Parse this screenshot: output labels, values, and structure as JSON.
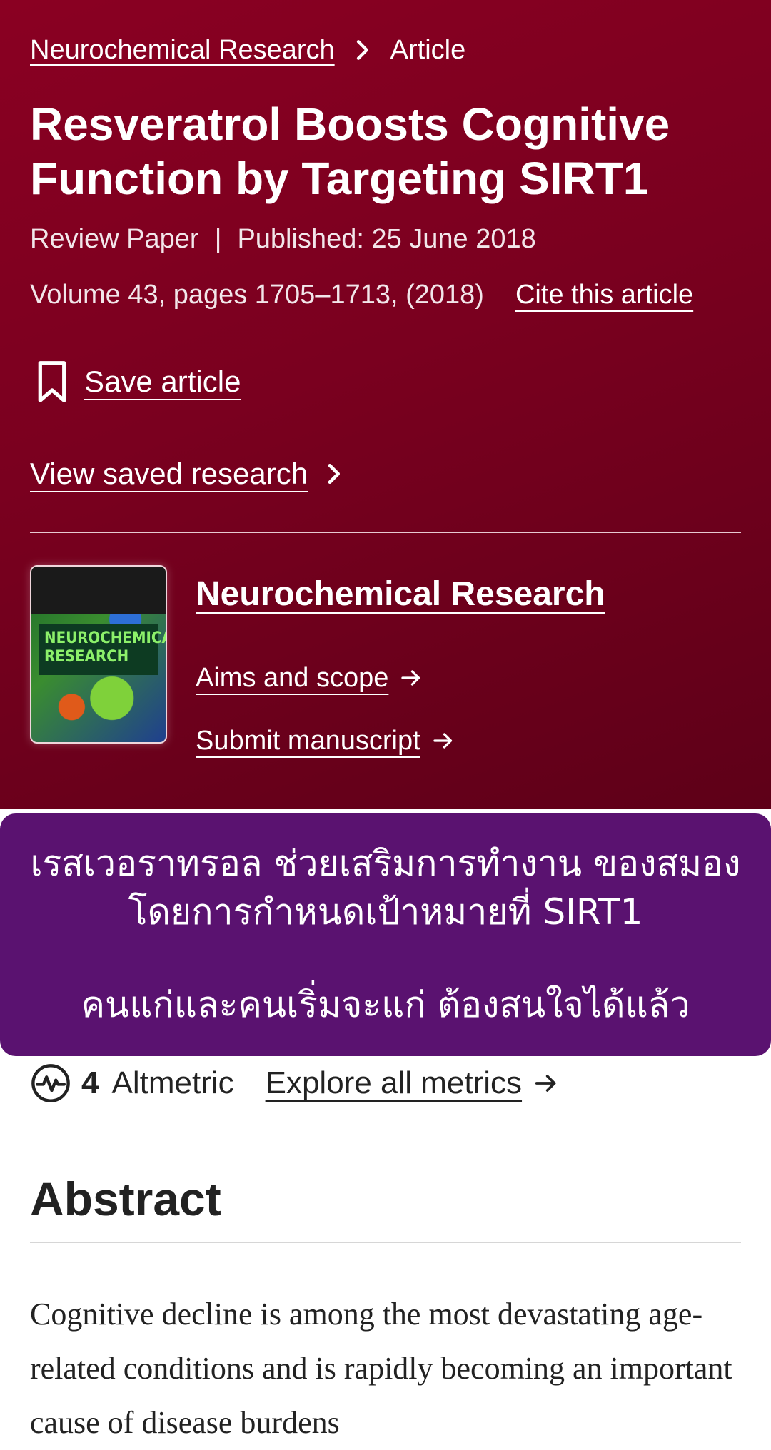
{
  "breadcrumb": {
    "journal_link": "Neurochemical Research",
    "current": "Article"
  },
  "article": {
    "title": "Resveratrol Boosts Cognitive Function by Targeting SIRT1",
    "type": "Review Paper",
    "separator": "|",
    "published": "Published: 25 June 2018",
    "volume_pages": "Volume 43, pages 1705–1713, (2018)",
    "cite_label": "Cite this article"
  },
  "actions": {
    "save_label": "Save article",
    "view_saved_label": "View saved research"
  },
  "journal": {
    "name": "Neurochemical Research",
    "cover_text": "NEUROCHEMICAL RESEARCH",
    "aims_label": "Aims and scope",
    "submit_label": "Submit manuscript"
  },
  "overlay": {
    "line1": "เรสเวอราทรอล ช่วยเสริมการทำงาน ของสมองโดยการกำหนดเป้าหมายที่ SIRT1",
    "line2": "คนแก่และคนเริ่มจะแก่ ต้องสนใจได้แล้ว",
    "background_color": "#5a1270"
  },
  "metrics": {
    "altmetric_count": "4",
    "altmetric_label": "Altmetric",
    "explore_label": "Explore all metrics"
  },
  "abstract": {
    "heading": "Abstract",
    "text": "Cognitive decline is among the most devastating age-related conditions and is rapidly becoming an important cause of disease burdens"
  },
  "colors": {
    "hero_background": "#7a001f",
    "text_light": "#ffffff",
    "text_dark": "#222222"
  }
}
